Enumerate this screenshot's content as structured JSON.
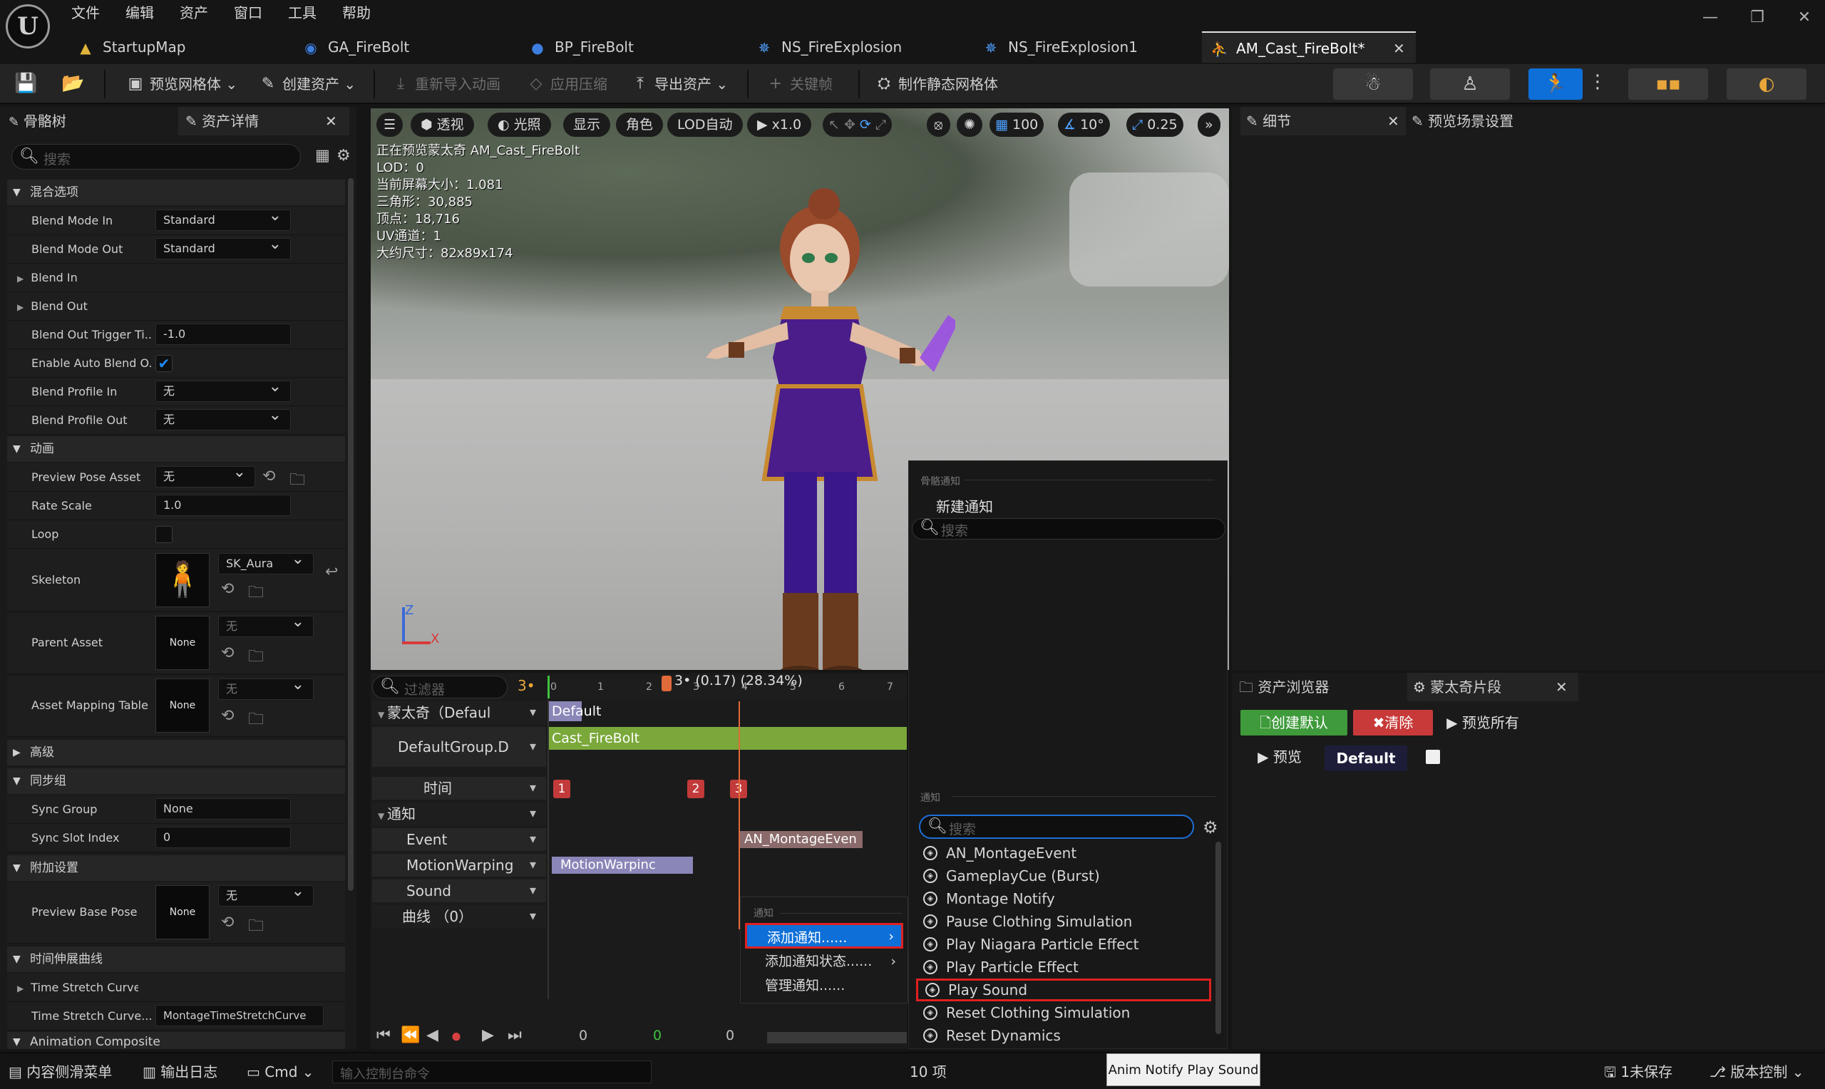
{
  "menu": [
    "文件",
    "编辑",
    "资产",
    "窗口",
    "工具",
    "帮助"
  ],
  "tabs": [
    {
      "label": "StartupMap",
      "icon": "level-icon",
      "color": "#e0b43a"
    },
    {
      "label": "GA_FireBolt",
      "icon": "blueprint-icon",
      "color": "#3c7de0"
    },
    {
      "label": "BP_FireBolt",
      "icon": "actor-icon",
      "color": "#3c7de0"
    },
    {
      "label": "NS_FireExplosion",
      "icon": "niagara-icon",
      "color": "#4ea0ff"
    },
    {
      "label": "NS_FireExplosion1",
      "icon": "niagara-icon",
      "color": "#4ea0ff"
    },
    {
      "label": "AM_Cast_FireBolt*",
      "icon": "montage-icon",
      "color": "#7a8be0"
    }
  ],
  "toolbar": {
    "preview_mesh": "预览网格体",
    "create_asset": "创建资产",
    "reimport": "重新导入动画",
    "apply_compression": "应用压缩",
    "export_asset": "导出资产",
    "keyframe": "关键帧",
    "make_static_mesh": "制作静态网格体"
  },
  "left": {
    "tab1": "骨骼树",
    "tab2": "资产详情",
    "search_placeholder": "搜索",
    "cat_blend": "混合选项",
    "cat_anim": "动画",
    "cat_adv": "高级",
    "cat_sync": "同步组",
    "cat_extra": "附加设置",
    "cat_timestretch": "时间伸展曲线",
    "cat_comp": "Animation Composite",
    "blend_mode_in": "Blend Mode In",
    "blend_mode_in_val": "Standard",
    "blend_mode_out": "Blend Mode Out",
    "blend_mode_out_val": "Standard",
    "blend_in": "Blend In",
    "blend_out": "Blend Out",
    "blend_out_trigger": "Blend Out Trigger Ti...",
    "blend_out_trigger_val": "-1.0",
    "enable_auto": "Enable Auto Blend O...",
    "enable_auto_val": "✔",
    "profile_in": "Blend Profile In",
    "profile_in_val": "无",
    "profile_out": "Blend Profile Out",
    "profile_out_val": "无",
    "preview_pose": "Preview Pose Asset",
    "preview_pose_val": "无",
    "rate_scale": "Rate Scale",
    "rate_scale_val": "1.0",
    "loop": "Loop",
    "skeleton": "Skeleton",
    "skeleton_val": "SK_Aura",
    "parent_asset": "Parent Asset",
    "parent_thumb": "None",
    "parent_val": "无",
    "mapping": "Asset Mapping Table",
    "mapping_thumb": "None",
    "mapping_val": "无",
    "sync_group": "Sync Group",
    "sync_group_val": "None",
    "sync_slot": "Sync Slot Index",
    "sync_slot_val": "0",
    "base_pose": "Preview Base Pose",
    "base_thumb": "None",
    "base_val": "无",
    "ts_curve": "Time Stretch Curve",
    "ts_curve_name": "Time Stretch Curve...",
    "ts_curve_name_val": "MontageTimeStretchCurve"
  },
  "viewport": {
    "perspective": "透视",
    "lit": "光照",
    "show": "显示",
    "character": "角色",
    "lod": "LOD自动",
    "speed": "x1.0",
    "grid": "100",
    "angle": "10°",
    "scale": "0.25",
    "stats": [
      "正在预览蒙太奇 AM_Cast_FireBolt",
      "LOD：0",
      "当前屏幕大小：1.081",
      "三角形：30,885",
      "顶点：18,716",
      "UV通道：1",
      "大约尺寸：82x89x174"
    ],
    "axis_z": "Z",
    "axis_x": "X"
  },
  "timeline": {
    "filter": "过滤器",
    "montage_row": "蒙太奇（Defaul",
    "group_row": "DefaultGroup.D",
    "time_row": "时间",
    "notify_row": "通知",
    "event_row": "Event",
    "warp_row": "MotionWarping",
    "sound_row": "Sound",
    "curve_row": "曲线 （0）",
    "playhead": "3• (0.17) (28.34%)",
    "ticks": [
      "0",
      "1",
      "2",
      "3",
      "4",
      "5",
      "6",
      "7"
    ],
    "slot_label": "Default",
    "segment": "Cast_FireBolt",
    "markers": [
      "1",
      "2",
      "3"
    ],
    "notify_event": "AN_MontageEven",
    "notify_warp": "MotionWarpinc",
    "counters": [
      "0",
      "0",
      "0"
    ],
    "ctx_header": "通知",
    "ctx_add": "添加通知......",
    "ctx_add_state": "添加通知状态......",
    "ctx_manage": "管理通知......"
  },
  "notify_popup": {
    "skel_header": "骨骼通知",
    "new_notify": "新建通知",
    "search_placeholder": "搜索",
    "header2": "通知",
    "items": [
      "AN_MontageEvent",
      "GameplayCue (Burst)",
      "Montage Notify",
      "Pause Clothing Simulation",
      "Play Niagara Particle Effect",
      "Play Particle Effect",
      "Play Sound",
      "Reset Clothing Simulation",
      "Reset Dynamics"
    ],
    "count": "10 项"
  },
  "right": {
    "details_tab": "细节",
    "scene_tab": "预览场景设置",
    "asset_browser": "资产浏览器",
    "montage_sections": "蒙太奇片段",
    "create_default": "创建默认",
    "clear": "清除",
    "preview_all": "预览所有",
    "preview": "预览",
    "default_section": "Default"
  },
  "status": {
    "drawer": "内容侧滑菜单",
    "output": "输出日志",
    "cmd": "Cmd",
    "console_placeholder": "输入控制台命令",
    "unsaved": "1未保存",
    "source_control": "版本控制",
    "tooltip": "Anim Notify Play Sound"
  },
  "colors": {
    "accent": "#0e6fd8",
    "highlight_red": "#e02020",
    "segment_green": "#7aa83a",
    "marker_red": "#c23a3a",
    "notify_purple": "#8a86b8"
  }
}
